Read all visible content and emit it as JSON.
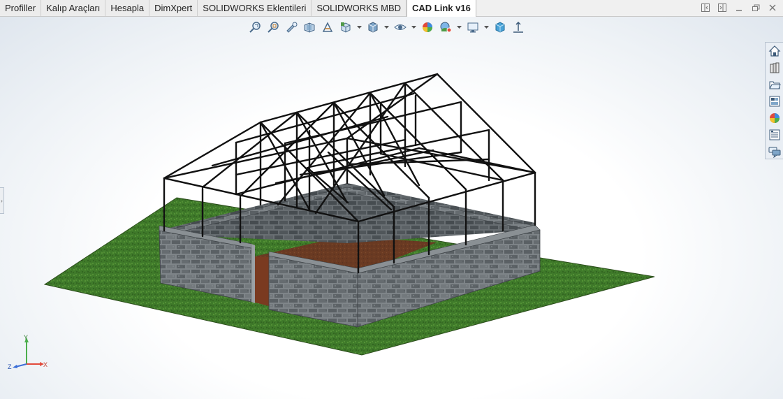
{
  "tabs": [
    {
      "label": "Profiller",
      "active": false
    },
    {
      "label": "Kalıp Araçları",
      "active": false
    },
    {
      "label": "Hesapla",
      "active": false
    },
    {
      "label": "DimXpert",
      "active": false
    },
    {
      "label": "SOLIDWORKS Eklentileri",
      "active": false
    },
    {
      "label": "SOLIDWORKS MBD",
      "active": false
    },
    {
      "label": "CAD Link v16",
      "active": true
    }
  ],
  "window_controls": [
    "tile-left-icon",
    "tile-right-icon",
    "minimize-icon",
    "restore-icon",
    "close-icon"
  ],
  "hud_toolbar": [
    "zoom-to-fit-icon",
    "zoom-to-area-icon",
    "previous-view-icon",
    "section-view-icon",
    "dynamic-annotation-icon",
    "view-orientation-icon",
    "display-style-icon",
    "hide-show-items-icon",
    "edit-appearance-icon",
    "apply-scene-icon",
    "view-settings-icon",
    "isometric-cube-icon",
    "normal-to-icon"
  ],
  "task_pane": [
    "home-icon",
    "design-library-icon",
    "file-explorer-icon",
    "view-palette-icon",
    "appearances-icon",
    "custom-properties-icon",
    "forum-icon"
  ],
  "triad": {
    "y": "Y",
    "x": "X",
    "z": "Z"
  },
  "colors": {
    "grass": "#3f7a2a",
    "stone": "#6e7478",
    "soil": "#6a3a22",
    "frame": "#111111"
  }
}
